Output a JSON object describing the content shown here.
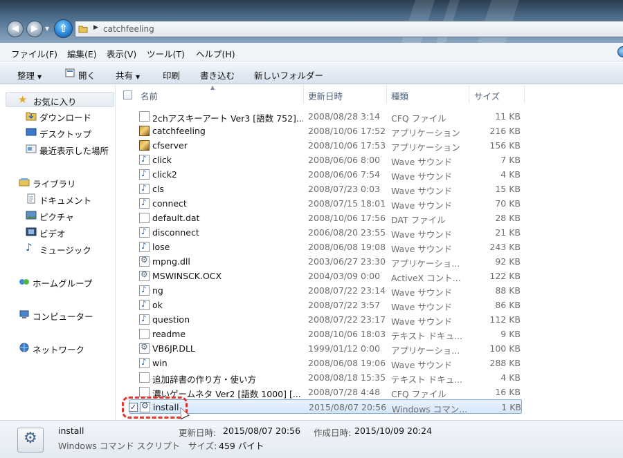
{
  "address": {
    "path": "catchfeeling"
  },
  "menu": [
    "ファイル(F)",
    "編集(E)",
    "表示(V)",
    "ツール(T)",
    "ヘルプ(H)"
  ],
  "toolbar": {
    "organize": "整理",
    "open": "開く",
    "share": "共有",
    "print": "印刷",
    "burn": "書き込む",
    "new_folder": "新しいフォルダー"
  },
  "nav": {
    "favorites": "お気に入り",
    "downloads": "ダウンロード",
    "desktop": "デスクトップ",
    "recent": "最近表示した場所",
    "libraries": "ライブラリ",
    "documents": "ドキュメント",
    "pictures": "ピクチャ",
    "videos": "ビデオ",
    "music": "ミュージック",
    "homegroup": "ホームグループ",
    "computer": "コンピューター",
    "network": "ネットワーク"
  },
  "columns": {
    "name": "名前",
    "date": "更新日時",
    "type": "種類",
    "size": "サイズ"
  },
  "files": [
    {
      "name": "2chアスキーアート Ver3 [語数 752]...",
      "date": "2008/08/28 3:14",
      "type": "CFQ ファイル",
      "size": "11 KB",
      "icon": "doc"
    },
    {
      "name": "catchfeeling",
      "date": "2008/10/06 17:52",
      "type": "アプリケーション",
      "size": "216 KB",
      "icon": "app"
    },
    {
      "name": "cfserver",
      "date": "2008/10/06 17:53",
      "type": "アプリケーション",
      "size": "156 KB",
      "icon": "app"
    },
    {
      "name": "click",
      "date": "2008/06/06 8:00",
      "type": "Wave サウンド",
      "size": "7 KB",
      "icon": "wav"
    },
    {
      "name": "click2",
      "date": "2008/06/06 7:54",
      "type": "Wave サウンド",
      "size": "4 KB",
      "icon": "wav"
    },
    {
      "name": "cls",
      "date": "2008/07/23 0:03",
      "type": "Wave サウンド",
      "size": "15 KB",
      "icon": "wav"
    },
    {
      "name": "connect",
      "date": "2008/07/15 18:01",
      "type": "Wave サウンド",
      "size": "70 KB",
      "icon": "wav"
    },
    {
      "name": "default.dat",
      "date": "2008/10/06 17:56",
      "type": "DAT ファイル",
      "size": "28 KB",
      "icon": "doc"
    },
    {
      "name": "disconnect",
      "date": "2006/08/20 23:55",
      "type": "Wave サウンド",
      "size": "21 KB",
      "icon": "wav"
    },
    {
      "name": "lose",
      "date": "2008/06/08 19:08",
      "type": "Wave サウンド",
      "size": "243 KB",
      "icon": "wav"
    },
    {
      "name": "mpng.dll",
      "date": "2003/06/27 23:30",
      "type": "アプリケーショ...",
      "size": "92 KB",
      "icon": "dll"
    },
    {
      "name": "MSWINSCK.OCX",
      "date": "2004/03/09 0:00",
      "type": "ActiveX コント...",
      "size": "122 KB",
      "icon": "dll"
    },
    {
      "name": "ng",
      "date": "2008/07/22 23:14",
      "type": "Wave サウンド",
      "size": "88 KB",
      "icon": "wav"
    },
    {
      "name": "ok",
      "date": "2008/07/22 3:57",
      "type": "Wave サウンド",
      "size": "86 KB",
      "icon": "wav"
    },
    {
      "name": "question",
      "date": "2008/07/22 23:17",
      "type": "Wave サウンド",
      "size": "112 KB",
      "icon": "wav"
    },
    {
      "name": "readme",
      "date": "2008/10/06 18:03",
      "type": "テキスト ドキュ...",
      "size": "9 KB",
      "icon": "doc"
    },
    {
      "name": "VB6JP.DLL",
      "date": "1999/01/12 0:00",
      "type": "アプリケーショ...",
      "size": "100 KB",
      "icon": "dll"
    },
    {
      "name": "win",
      "date": "2008/06/08 19:06",
      "type": "Wave サウンド",
      "size": "288 KB",
      "icon": "wav"
    },
    {
      "name": "追加辞書の作り方・使い方",
      "date": "2008/08/18 15:35",
      "type": "テキスト ドキュ...",
      "size": "4 KB",
      "icon": "doc"
    },
    {
      "name": "濃いゲームネタ Ver2 [語数 1000] [...",
      "date": "2008/07/28 4:48",
      "type": "CFQ ファイル",
      "size": "16 KB",
      "icon": "doc"
    },
    {
      "name": "install",
      "date": "2015/08/07 20:56",
      "type": "Windows コマン...",
      "size": "1 KB",
      "icon": "cmd",
      "selected": true
    }
  ],
  "details": {
    "name": "install",
    "type": "Windows コマンド スクリプト",
    "modified_label": "更新日時:",
    "modified": "2015/08/07 20:56",
    "created_label": "作成日時:",
    "created": "2015/10/09 20:24",
    "size_label": "サイズ:",
    "size": "459 バイト"
  }
}
